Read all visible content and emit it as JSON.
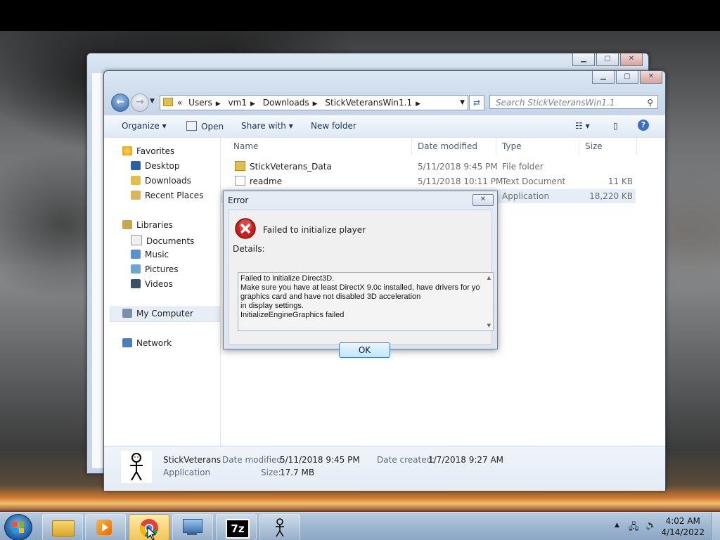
{
  "explorer": {
    "address": {
      "prefix": "«",
      "crumbs": [
        "Users",
        "vm1",
        "Downloads",
        "StickVeteransWin1.1"
      ]
    },
    "search_placeholder": "Search StickVeteransWin1.1",
    "toolbar": {
      "organize": "Organize",
      "open": "Open",
      "share_with": "Share with",
      "new_folder": "New folder"
    },
    "nav": {
      "favorites": "Favorites",
      "desktop": "Desktop",
      "downloads": "Downloads",
      "recent_places": "Recent Places",
      "libraries": "Libraries",
      "documents": "Documents",
      "music": "Music",
      "pictures": "Pictures",
      "videos": "Videos",
      "my_computer": "My Computer",
      "network": "Network"
    },
    "columns": {
      "name": "Name",
      "date_modified": "Date modified",
      "type": "Type",
      "size": "Size"
    },
    "files": [
      {
        "name": "StickVeterans_Data",
        "date": "5/11/2018 9:45 PM",
        "type": "File folder",
        "size": ""
      },
      {
        "name": "readme",
        "date": "5/11/2018 10:11 PM",
        "type": "Text Document",
        "size": "11 KB"
      },
      {
        "name": "",
        "date": "",
        "type": "Application",
        "size": "18,220 KB"
      }
    ],
    "details_pane": {
      "name": "StickVeterans",
      "kind": "Application",
      "date_modified_label": "Date modified:",
      "date_modified": "5/11/2018 9:45 PM",
      "size_label": "Size:",
      "size": "17.7 MB",
      "date_created_label": "Date created:",
      "date_created": "1/7/2018 9:27 AM"
    }
  },
  "error_dialog": {
    "title": "Error",
    "message": "Failed to initialize player",
    "details_label": "Details:",
    "details_text": "Failed to initialize Direct3D.\nMake sure you have at least DirectX 9.0c installed, have drivers for yo\ngraphics card and have not disabled 3D acceleration\nin display settings.\nInitializeEngineGraphics failed",
    "ok": "OK"
  },
  "taskbar": {
    "buttons": [
      "explorer",
      "media-player",
      "chrome",
      "network-connections",
      "7zip",
      "stickveterans"
    ],
    "sevenzip_label": "7z",
    "clock_time": "4:02 AM",
    "clock_date": "4/14/2022"
  }
}
